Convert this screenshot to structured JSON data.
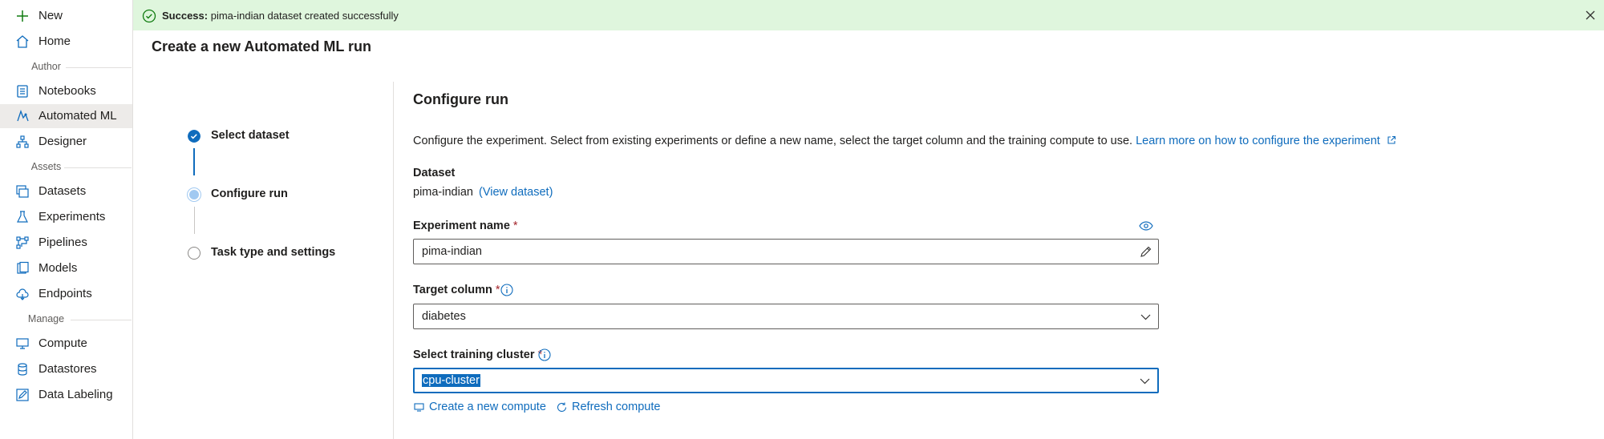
{
  "sidebar": {
    "new": "New",
    "home": "Home",
    "section_author": "Author",
    "notebooks": "Notebooks",
    "automated_ml": "Automated ML",
    "designer": "Designer",
    "section_assets": "Assets",
    "datasets": "Datasets",
    "experiments": "Experiments",
    "pipelines": "Pipelines",
    "models": "Models",
    "endpoints": "Endpoints",
    "section_manage": "Manage",
    "compute": "Compute",
    "datastores": "Datastores",
    "data_labeling": "Data Labeling"
  },
  "banner": {
    "prefix": "Success:",
    "message": "pima-indian dataset created successfully"
  },
  "page_title": "Create a new Automated ML run",
  "steps": [
    {
      "label": "Select dataset",
      "state": "completed"
    },
    {
      "label": "Configure run",
      "state": "current"
    },
    {
      "label": "Task type and settings",
      "state": "pending"
    }
  ],
  "configure": {
    "title": "Configure run",
    "description": "Configure the experiment. Select from existing experiments or define a new name, select the target column and the training compute to use.",
    "learn_more": "Learn more on how to configure the experiment",
    "dataset_label": "Dataset",
    "dataset_value": "pima-indian",
    "view_dataset": "(View dataset)",
    "experiment_label": "Experiment name",
    "experiment_value": "pima-indian",
    "target_label": "Target column",
    "target_value": "diabetes",
    "cluster_label": "Select training cluster",
    "cluster_value": "cpu-cluster",
    "required_mark": "*",
    "create_compute": "Create a new compute",
    "refresh_compute": "Refresh compute"
  },
  "colors": {
    "accent": "#0f6cbd",
    "success_bg": "#dff6dd",
    "success_icon": "#107c10",
    "required": "#a4262c"
  }
}
